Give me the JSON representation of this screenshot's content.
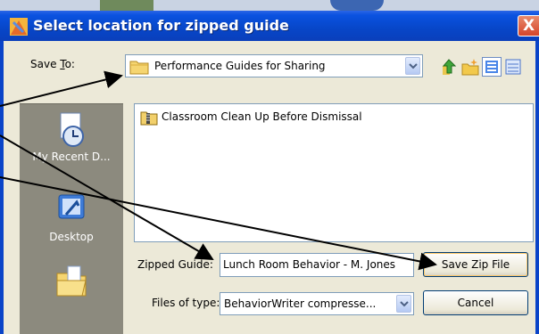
{
  "window": {
    "title": "Select location for zipped guide",
    "close_glyph": "X"
  },
  "save_to": {
    "label": "Save To:",
    "value": "Performance Guides for Sharing"
  },
  "toolbar": {
    "icons": [
      "up-folder-icon",
      "new-folder-icon",
      "list-view-icon",
      "details-view-icon"
    ]
  },
  "places": [
    {
      "label": "My Recent D...",
      "icon": "recent-documents-icon"
    },
    {
      "label": "Desktop",
      "icon": "desktop-icon"
    },
    {
      "label": "",
      "icon": "my-documents-icon"
    }
  ],
  "files": [
    {
      "name": "Classroom Clean Up Before Dismissal",
      "icon": "zip-file-icon"
    }
  ],
  "zipped_guide": {
    "label": "Zipped Guide:",
    "value": "Lunch Room Behavior - M. Jones"
  },
  "files_of_type": {
    "label": "Files of type:",
    "value": "BehaviorWriter compresse..."
  },
  "buttons": {
    "save": "Save Zip File",
    "cancel": "Cancel"
  },
  "colors": {
    "titlebar": "#0746c8",
    "dialog_bg": "#ece9d8",
    "places_bg": "#8c8a7e",
    "close_button": "#d5452a"
  }
}
